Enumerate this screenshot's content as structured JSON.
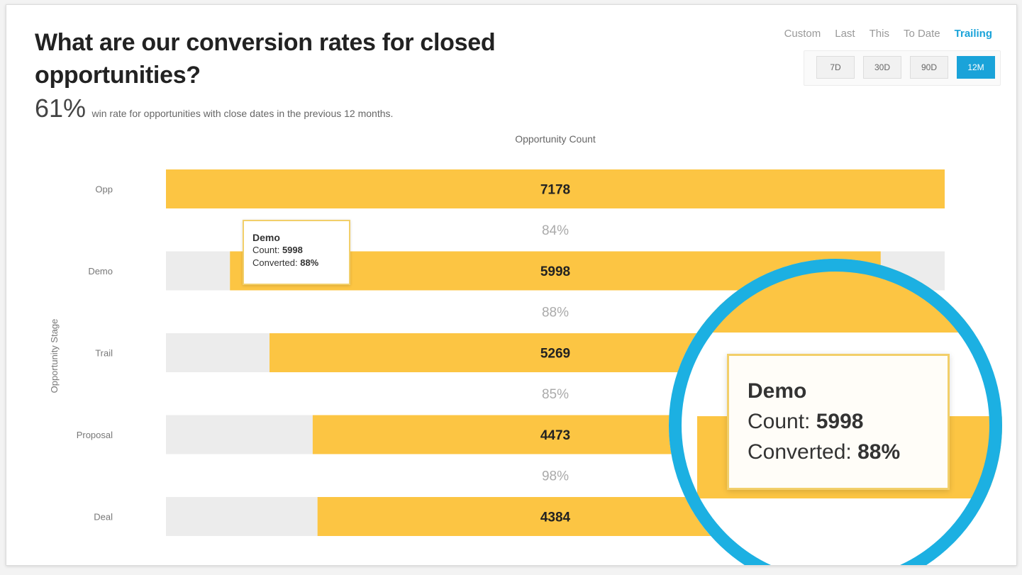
{
  "header": {
    "title": "What are our conversion rates for closed opportunities?",
    "summary_value": "61%",
    "summary_text": "win rate for opportunities with close dates in the previous 12 months."
  },
  "period_tabs": [
    "Custom",
    "Last",
    "This",
    "To Date",
    "Trailing"
  ],
  "period_active": "Trailing",
  "range_buttons": [
    "7D",
    "30D",
    "90D",
    "12M"
  ],
  "range_active": "12M",
  "colors": {
    "bar": "#fcc543",
    "track": "#ececec",
    "accent": "#1aa3d9",
    "ring": "#1cb0e2"
  },
  "tooltip": {
    "title": "Demo",
    "count_label": "Count:",
    "count_value": "5998",
    "converted_label": "Converted:",
    "converted_value": "88%"
  },
  "chart_data": {
    "type": "bar",
    "orientation": "horizontal",
    "style": "centered-funnel",
    "title": "Opportunity Count",
    "ylabel": "Opportunity Stage",
    "categories": [
      "Opp",
      "Demo",
      "Trail",
      "Proposal",
      "Deal"
    ],
    "values": [
      7178,
      5998,
      5269,
      4473,
      4384
    ],
    "conversion_rates": [
      "84%",
      "88%",
      "85%",
      "98%"
    ],
    "max": 7178,
    "grid": false,
    "legend": "none"
  }
}
